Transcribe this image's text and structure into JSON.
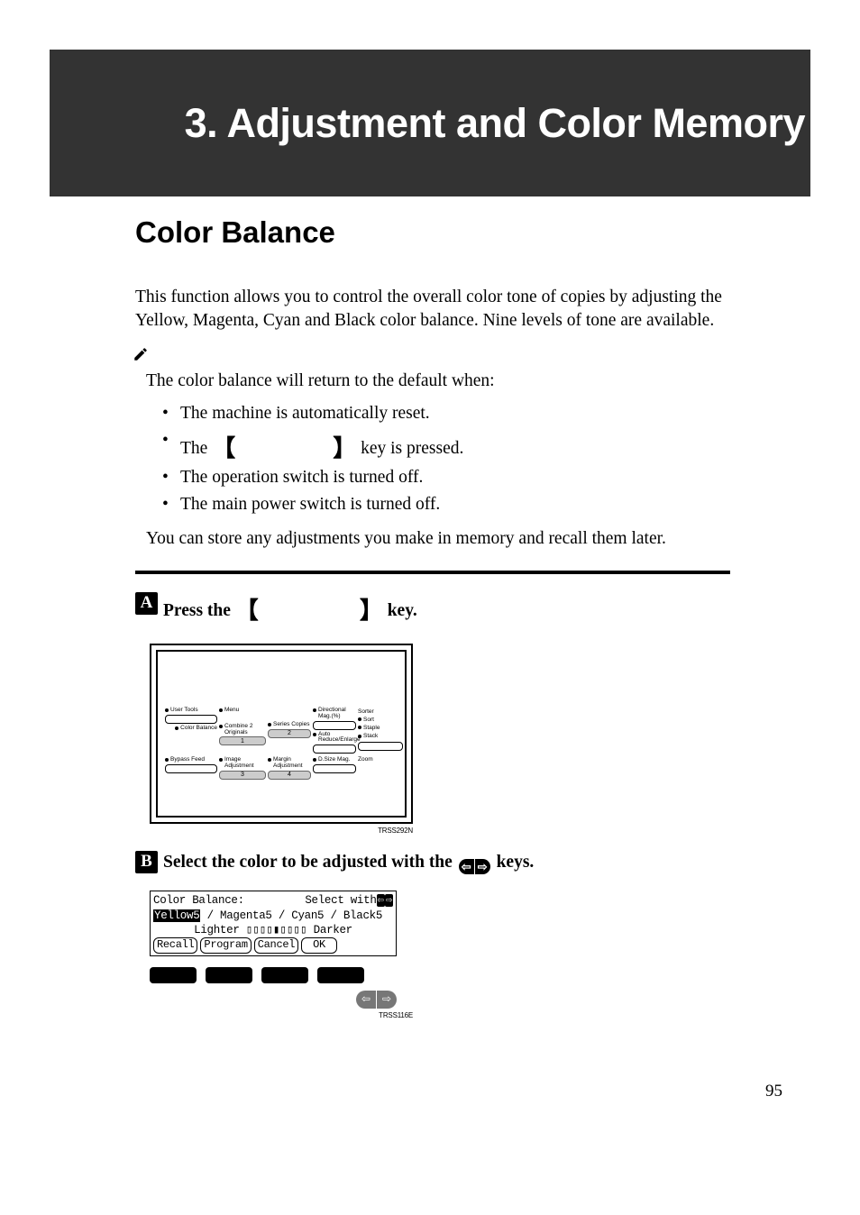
{
  "header": {
    "chapter_title": "3. Adjustment and Color Memory"
  },
  "section": {
    "title": "Color Balance"
  },
  "intro": "This function allows you to control the overall color tone of copies by adjusting the Yellow, Magenta, Cyan and Black color balance. Nine levels of tone are available.",
  "note": {
    "lead": "The color balance will return to the default when:",
    "items": [
      "The machine is automatically reset.",
      {
        "pre": "The ",
        "post": " key is pressed."
      },
      "The operation switch is turned off.",
      "The main power switch is turned off."
    ],
    "tail": "You can store any adjustments you make in memory and recall them later."
  },
  "steps": [
    {
      "pre": "Press the ",
      "post": " key."
    },
    {
      "pre": "Select the color to be adjusted with the ",
      "post": " keys."
    }
  ],
  "panel": {
    "labels": {
      "user_tools": "User Tools",
      "color_balance": "Color Balance",
      "menu": "Menu",
      "combine_2_originals": "Combine 2 Originals",
      "series_copies": "Series Copies",
      "directional_mag": "Directional Mag.(%)",
      "auto_reduce_enlarge": "Auto Reduce/Enlarge",
      "bypass_feed": "Bypass Feed",
      "image_adjustment": "Image Adjustment",
      "margin_adjustment": "Margin Adjustment",
      "d_size_mag": "D.Size Mag.",
      "zoom": "Zoom",
      "sorter": "Sorter",
      "sort": "Sort",
      "staple": "Staple",
      "stack": "Stack",
      "n1": "1",
      "n2": "2",
      "n3": "3",
      "n4": "4"
    },
    "code": "TRSS292N"
  },
  "lcd": {
    "title_left": "Color Balance:",
    "title_right": "Select with",
    "line2_selected": "Yellow5",
    "line2_rest": " / Magenta5 / Cyan5 / Black5",
    "line3_pre": "Lighter ",
    "line3_post": " Darker",
    "buttons": {
      "recall": "Recall",
      "program": "Program",
      "cancel": "Cancel",
      "ok": "OK"
    },
    "code": "TRSS116E"
  },
  "page_number": "95",
  "arrows": {
    "left": "⇦",
    "right": "⇨"
  }
}
